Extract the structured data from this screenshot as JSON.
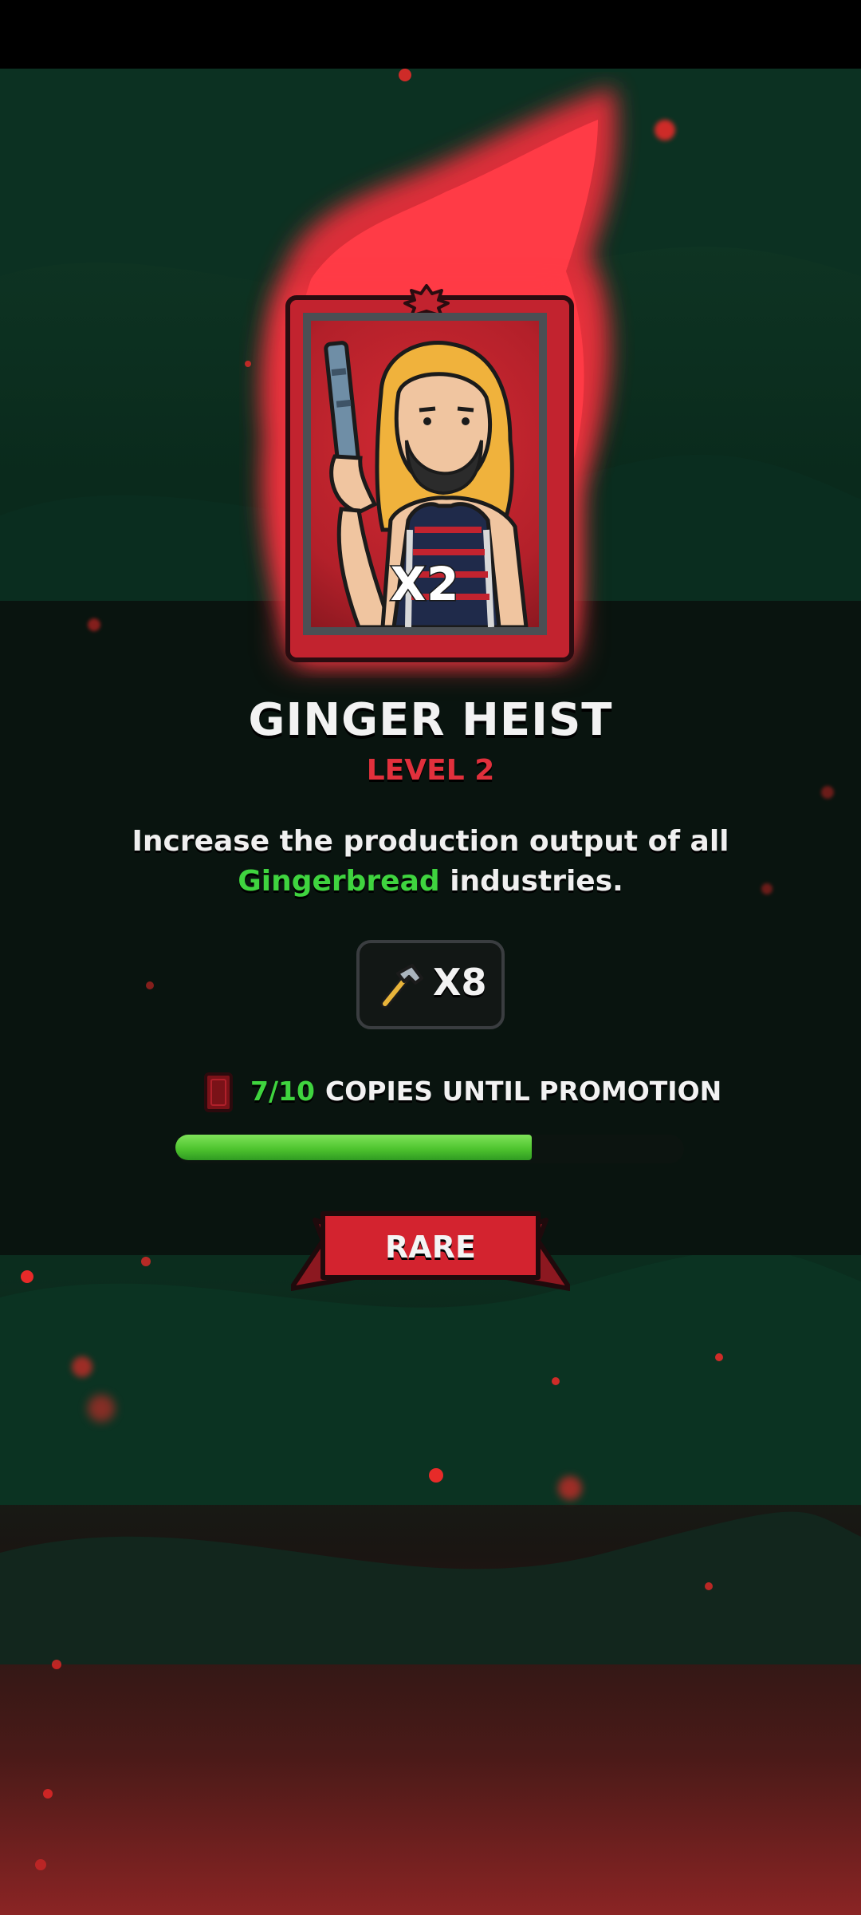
{
  "card": {
    "name": "GINGER HEIST",
    "level": "LEVEL 2",
    "multiplier": "X2",
    "description_before": "Increase the production output of all ",
    "description_highlight": "Gingerbread",
    "description_after": " industries.",
    "rarity": "RARE"
  },
  "reward": {
    "icon": "hammer-icon",
    "count": "X8"
  },
  "promotion": {
    "progress_text": "7/10",
    "label": "COPIES UNTIL PROMOTION",
    "copies_current": 7,
    "copies_needed": 10
  },
  "colors": {
    "accent_red": "#e1303c",
    "highlight_green": "#3fd43f",
    "progress_green": "#4fc52f"
  }
}
